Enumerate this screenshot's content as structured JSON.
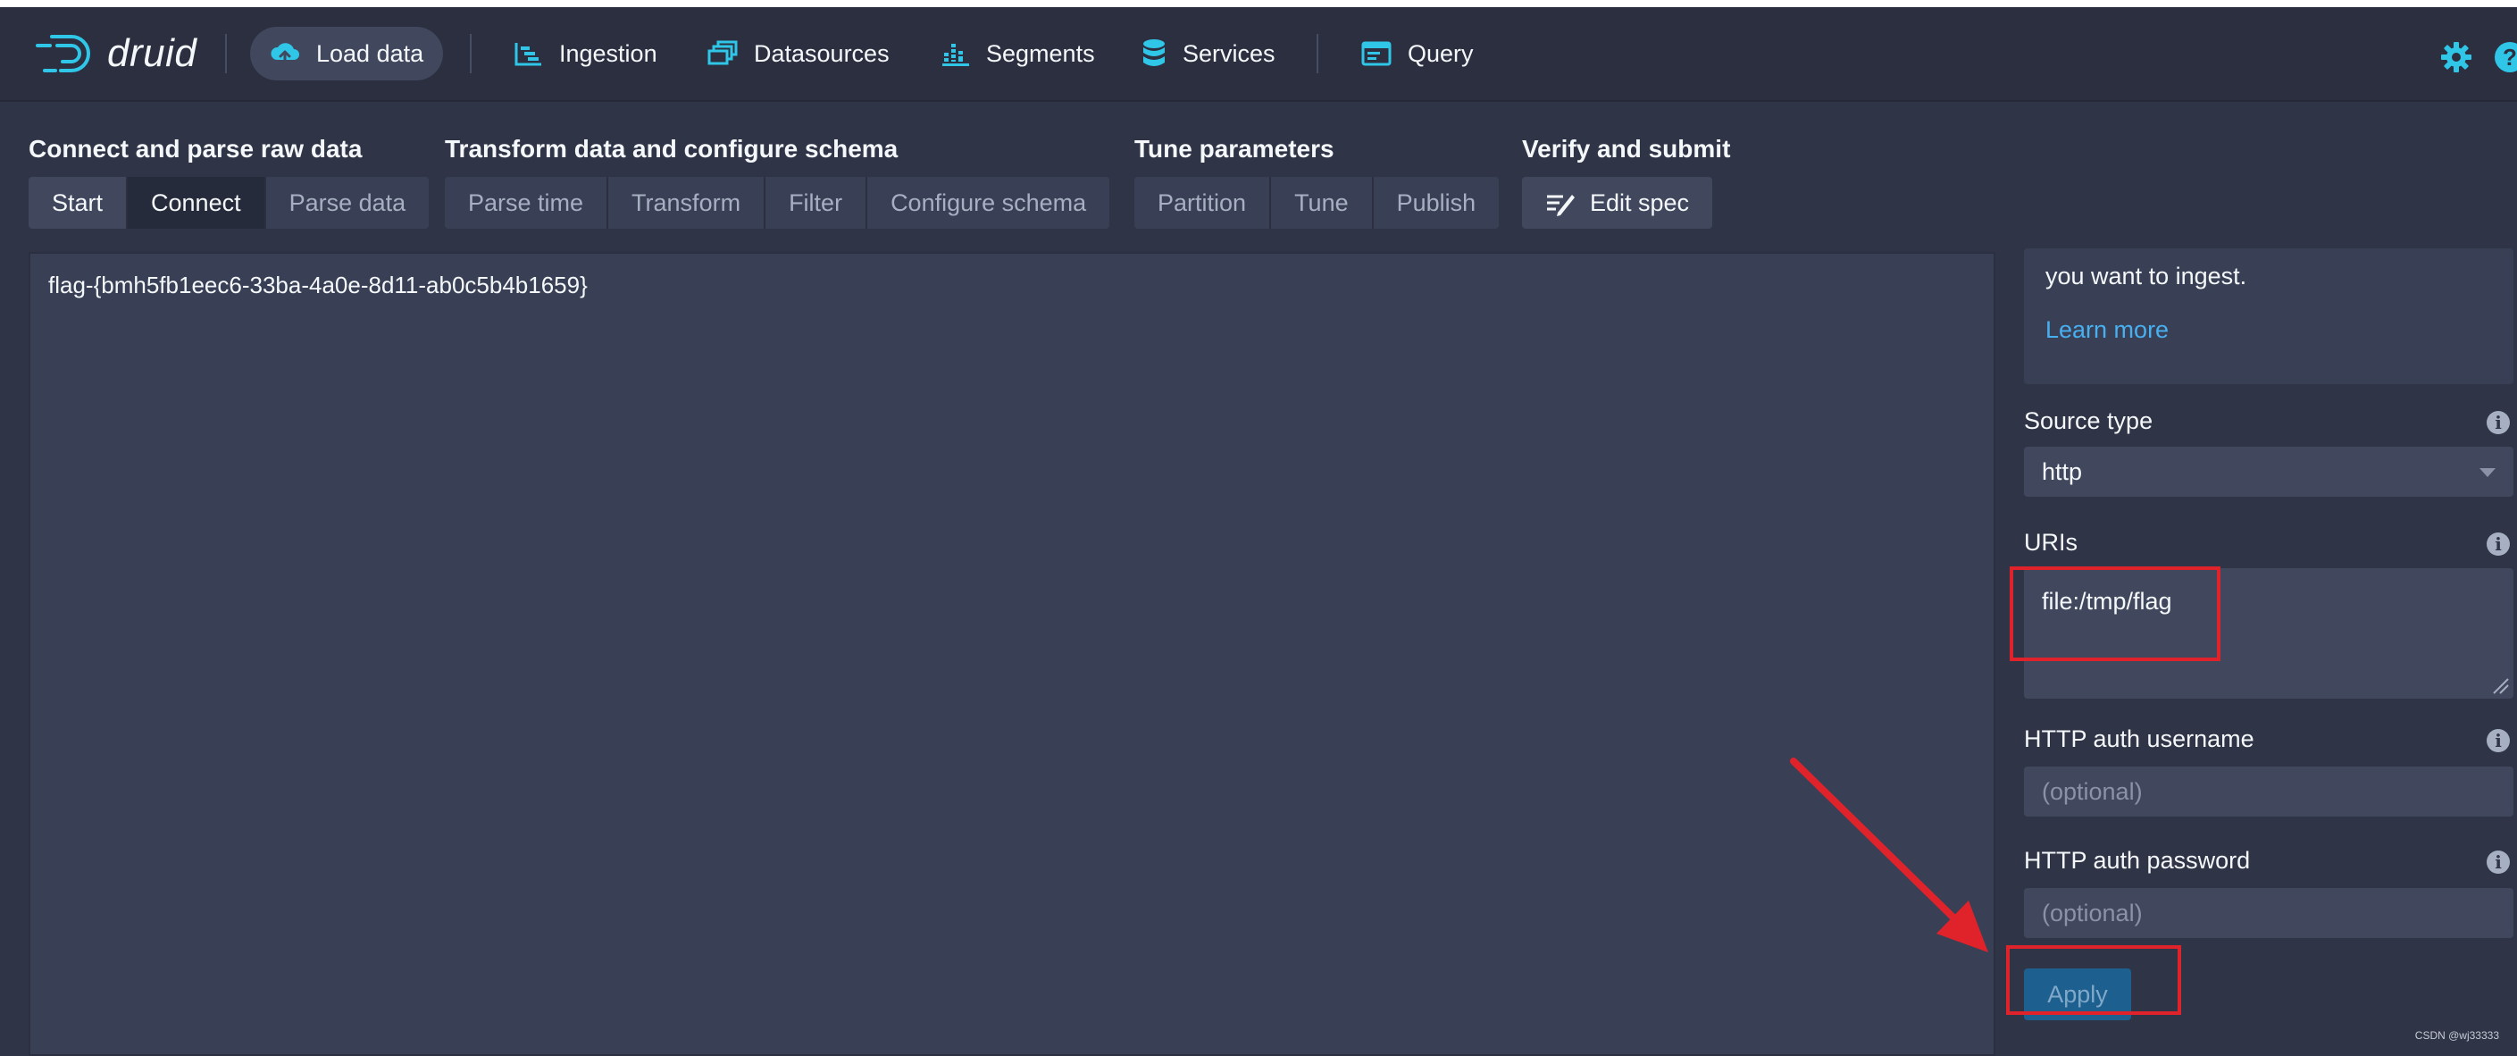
{
  "app": {
    "logo_text": "druid"
  },
  "nav": {
    "load_data": "Load data",
    "ingestion": "Ingestion",
    "datasources": "Datasources",
    "segments": "Segments",
    "services": "Services",
    "query": "Query"
  },
  "steps": {
    "group1": {
      "title": "Connect and parse raw data",
      "buttons": [
        "Start",
        "Connect",
        "Parse data"
      ]
    },
    "group2": {
      "title": "Transform data and configure schema",
      "buttons": [
        "Parse time",
        "Transform",
        "Filter",
        "Configure schema"
      ]
    },
    "group3": {
      "title": "Tune parameters",
      "buttons": [
        "Partition",
        "Tune",
        "Publish"
      ]
    },
    "group4": {
      "title": "Verify and submit",
      "buttons": [
        "Edit spec"
      ]
    }
  },
  "raw": {
    "line": "flag-{bmh5fb1eec6-33ba-4a0e-8d11-ab0c5b4b1659}"
  },
  "control": {
    "callout_text": "you want to ingest.",
    "learn_more": "Learn more",
    "source_type_label": "Source type",
    "source_type_value": "http",
    "uris_label": "URIs",
    "uris_value": "file:/tmp/flag",
    "auth_user_label": "HTTP auth username",
    "auth_user_placeholder": "(optional)",
    "auth_pass_label": "HTTP auth password",
    "auth_pass_placeholder": "(optional)",
    "apply": "Apply"
  },
  "icons": {
    "info": "i",
    "accent": "#2fc6e8",
    "annotation": "#e0232b"
  },
  "watermark": "CSDN @wj33333"
}
